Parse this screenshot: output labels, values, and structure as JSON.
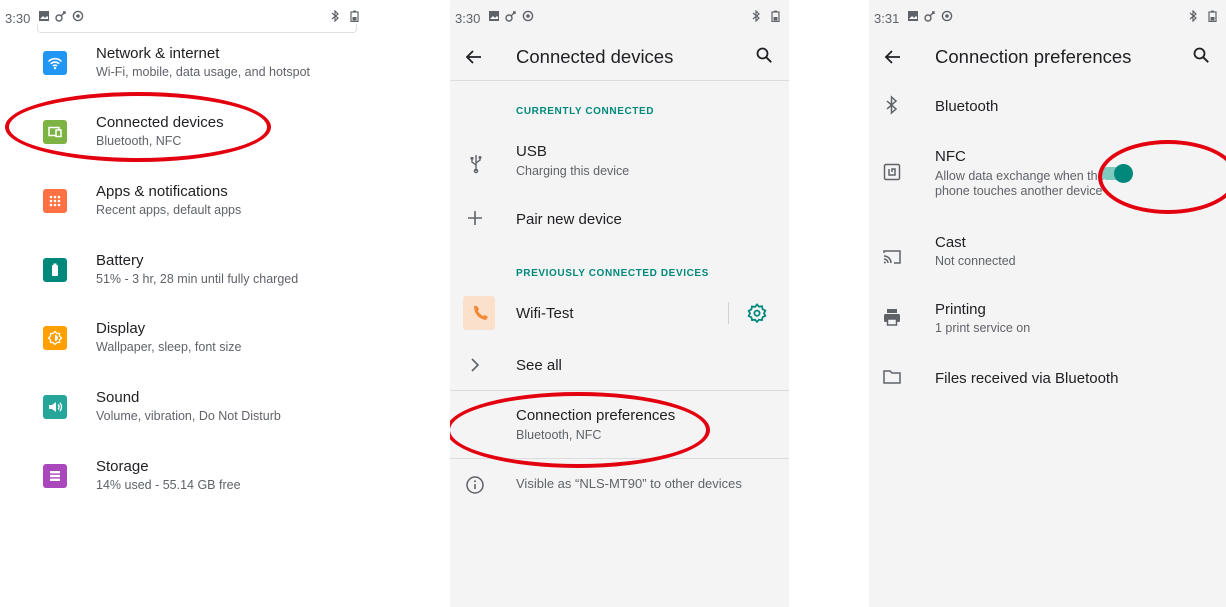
{
  "colors": {
    "accent": "#00897b",
    "annotation": "#e3000f"
  },
  "screen1": {
    "status_time": "3:30",
    "items": [
      {
        "title": "Network & internet",
        "subtitle": "Wi-Fi, mobile, data usage, and hotspot",
        "icon": "wifi-icon",
        "color": "#2196f3"
      },
      {
        "title": "Connected devices",
        "subtitle": "Bluetooth, NFC",
        "icon": "connected-devices-icon",
        "color": "#7cb342"
      },
      {
        "title": "Apps & notifications",
        "subtitle": "Recent apps, default apps",
        "icon": "apps-grid-icon",
        "color": "#ff7043"
      },
      {
        "title": "Battery",
        "subtitle": "51% - 3 hr, 28 min until fully charged",
        "icon": "battery-icon",
        "color": "#00897b"
      },
      {
        "title": "Display",
        "subtitle": "Wallpaper, sleep, font size",
        "icon": "brightness-icon",
        "color": "#ffa000"
      },
      {
        "title": "Sound",
        "subtitle": "Volume, vibration, Do Not Disturb",
        "icon": "volume-icon",
        "color": "#26a69a"
      },
      {
        "title": "Storage",
        "subtitle": "14% used - 55.14 GB free",
        "icon": "storage-icon",
        "color": "#ab47bc"
      }
    ]
  },
  "screen2": {
    "status_time": "3:30",
    "title": "Connected devices",
    "section_current": "CURRENTLY CONNECTED",
    "usb_title": "USB",
    "usb_subtitle": "Charging this device",
    "pair_label": "Pair new device",
    "section_previous": "PREVIOUSLY CONNECTED DEVICES",
    "device_name": "Wifi-Test",
    "see_all": "See all",
    "prefs_title": "Connection preferences",
    "prefs_subtitle": "Bluetooth, NFC",
    "visible_text": "Visible as “NLS-MT90” to other devices"
  },
  "screen3": {
    "status_time": "3:31",
    "title": "Connection preferences",
    "bluetooth": "Bluetooth",
    "nfc_title": "NFC",
    "nfc_sub1": "Allow data exchange when the",
    "nfc_sub2": "phone touches another device",
    "nfc_enabled": true,
    "cast_title": "Cast",
    "cast_subtitle": "Not connected",
    "printing_title": "Printing",
    "printing_subtitle": "1 print service on",
    "files_label": "Files received via Bluetooth"
  }
}
